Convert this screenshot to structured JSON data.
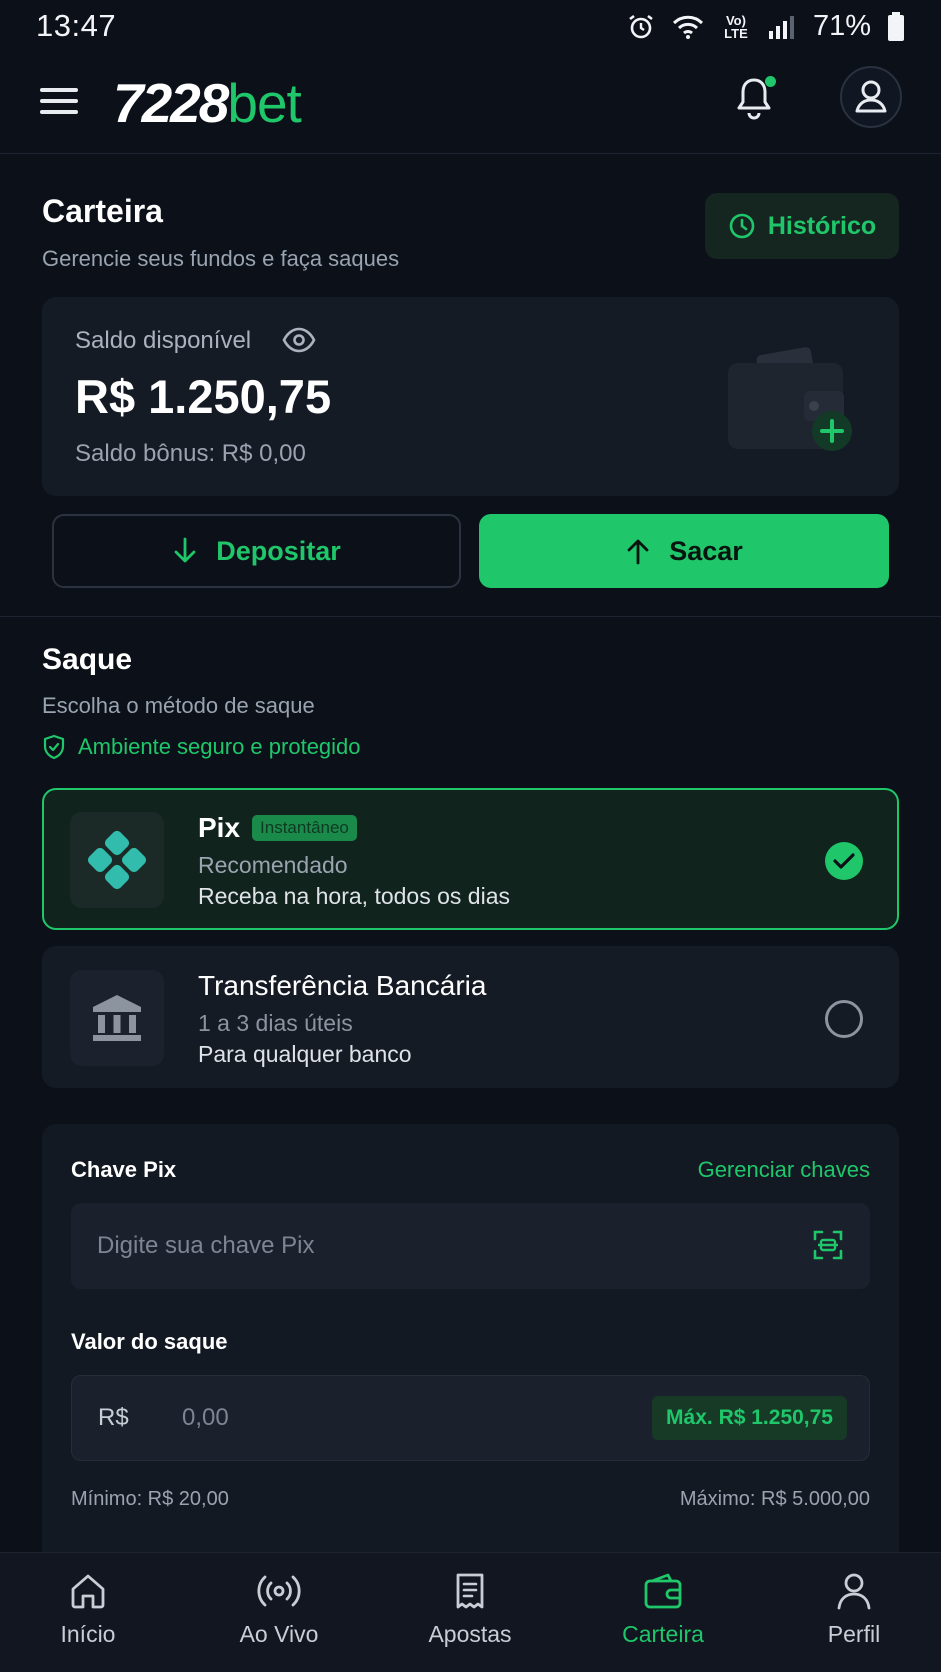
{
  "status_bar": {
    "time": "13:47",
    "network_label": "Vo) LTE",
    "battery": "71%",
    "icons": [
      "alarm-icon",
      "wifi-icon",
      "signal-icon",
      "battery-icon"
    ]
  },
  "header": {
    "logo_number": "7228",
    "logo_suffix": "bet",
    "icons": [
      "menu-icon",
      "bell-icon",
      "user-icon"
    ]
  },
  "wallet": {
    "title": "Carteira",
    "subtitle": "Gerencie seus fundos e faça saques",
    "history_label": "Histórico",
    "balance_label": "Saldo disponível",
    "balance_value": "R$ 1.250,75",
    "bonus_label": "Saldo bônus: R$ 0,00",
    "deposit_label": "Depositar",
    "withdraw_label": "Sacar"
  },
  "withdrawal": {
    "title": "Saque",
    "subtitle": "Escolha o método de saque",
    "secure_text": "Ambiente seguro e protegido",
    "methods": [
      {
        "name": "Pix",
        "badge": "Instantâneo",
        "line1": "Recomendado",
        "line2": "Receba na hora, todos os dias",
        "selected": true
      },
      {
        "name": "Transferência Bancária",
        "line1": "1 a 3 dias úteis",
        "line2": "Para qualquer banco",
        "selected": false
      }
    ]
  },
  "form": {
    "pix_key_label": "Chave Pix",
    "manage_keys_label": "Gerenciar chaves",
    "pix_key_placeholder": "Digite sua chave Pix",
    "amount_label": "Valor do saque",
    "currency": "R$",
    "amount_placeholder": "0,00",
    "max_button": "Máx. R$ 1.250,75",
    "min_text": "Mínimo: R$ 20,00",
    "max_text": "Máximo: R$ 5.000,00"
  },
  "bottom_nav": {
    "items": [
      {
        "label": "Início",
        "icon": "home-icon"
      },
      {
        "label": "Ao Vivo",
        "icon": "live-icon"
      },
      {
        "label": "Apostas",
        "icon": "bets-icon"
      },
      {
        "label": "Carteira",
        "icon": "wallet-icon"
      },
      {
        "label": "Perfil",
        "icon": "profile-icon"
      }
    ],
    "active": "Carteira"
  },
  "colors": {
    "background": "#0b1019",
    "accent": "#1fc76a",
    "card": "#151b25"
  }
}
